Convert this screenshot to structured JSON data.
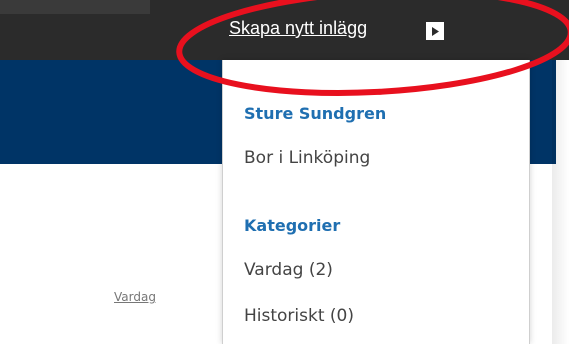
{
  "header": {
    "create_post_label": "Skapa nytt inlägg",
    "create_post_icon": "play-arrow-icon"
  },
  "profile_menu": {
    "name": "Sture Sundgren",
    "location": "Bor i Linköping",
    "categories_heading": "Kategorier",
    "categories": [
      {
        "label": "Vardag (2)"
      },
      {
        "label": "Historiskt (0)"
      }
    ]
  },
  "sidebar_link": "Vardag",
  "colors": {
    "topbar": "#2b2b2b",
    "bluebar": "#003466",
    "heading_blue": "#1f6fb1",
    "annotation_red": "#e8101e"
  }
}
